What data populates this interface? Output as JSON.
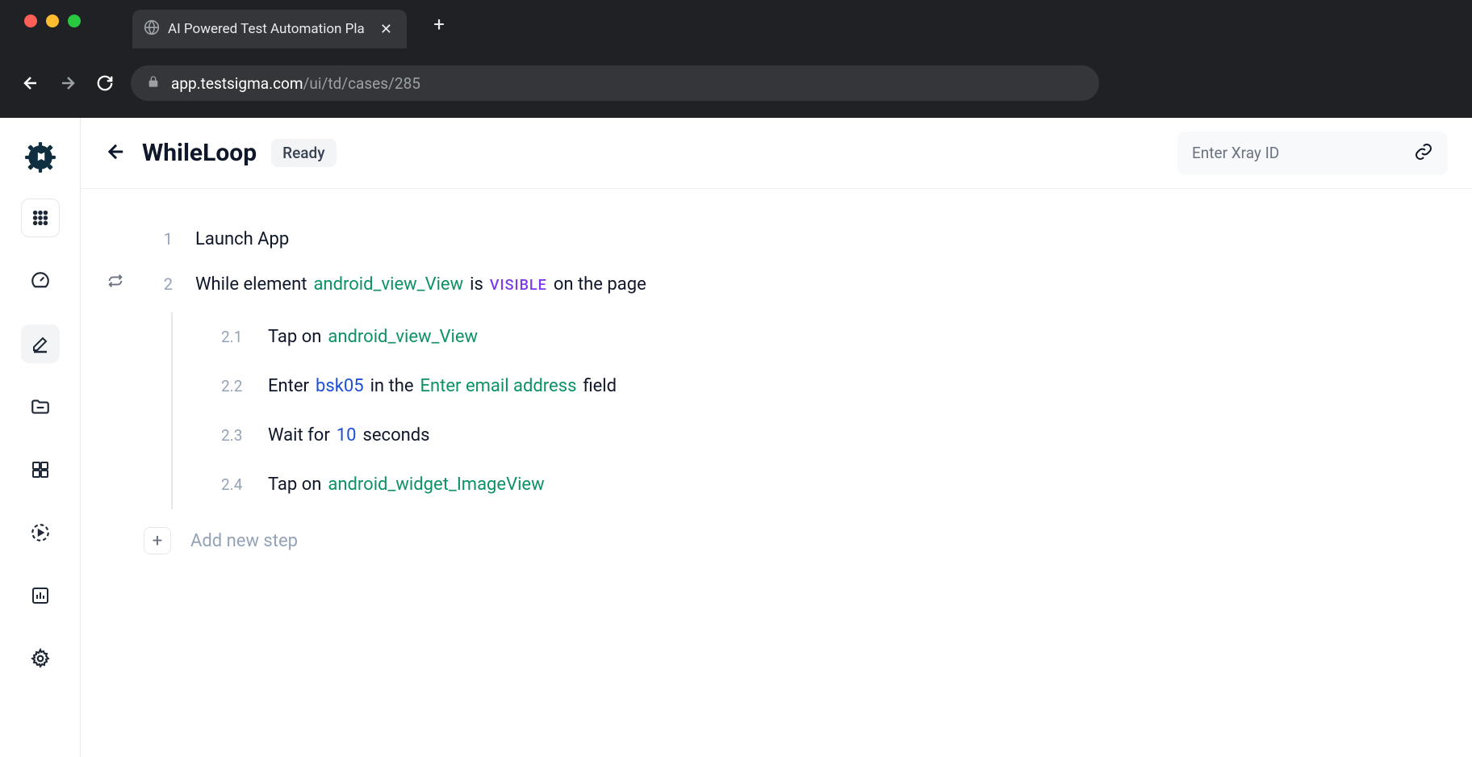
{
  "browser": {
    "tab_title": "AI Powered Test Automation Pla",
    "url_display_host": "app.testsigma.com",
    "url_display_path": "/ui/td/cases/285"
  },
  "header": {
    "title": "WhileLoop",
    "status": "Ready",
    "xray_placeholder": "Enter Xray ID"
  },
  "steps": {
    "s1": {
      "num": "1",
      "text": "Launch App"
    },
    "s2": {
      "num": "2",
      "pre": "While element",
      "elem": "android_view_View",
      "mid": "is",
      "state": "VISIBLE",
      "post": "on the page"
    },
    "s2_1": {
      "num": "2.1",
      "pre": "Tap on",
      "elem": "android_view_View"
    },
    "s2_2": {
      "num": "2.2",
      "pre": "Enter",
      "val": "bsk05",
      "mid": "in the",
      "elem": "Enter email address",
      "post": "field"
    },
    "s2_3": {
      "num": "2.3",
      "pre": "Wait for",
      "val": "10",
      "post": "seconds"
    },
    "s2_4": {
      "num": "2.4",
      "pre": "Tap on",
      "elem": "android_widget_ImageView"
    },
    "add_label": "Add new step"
  }
}
